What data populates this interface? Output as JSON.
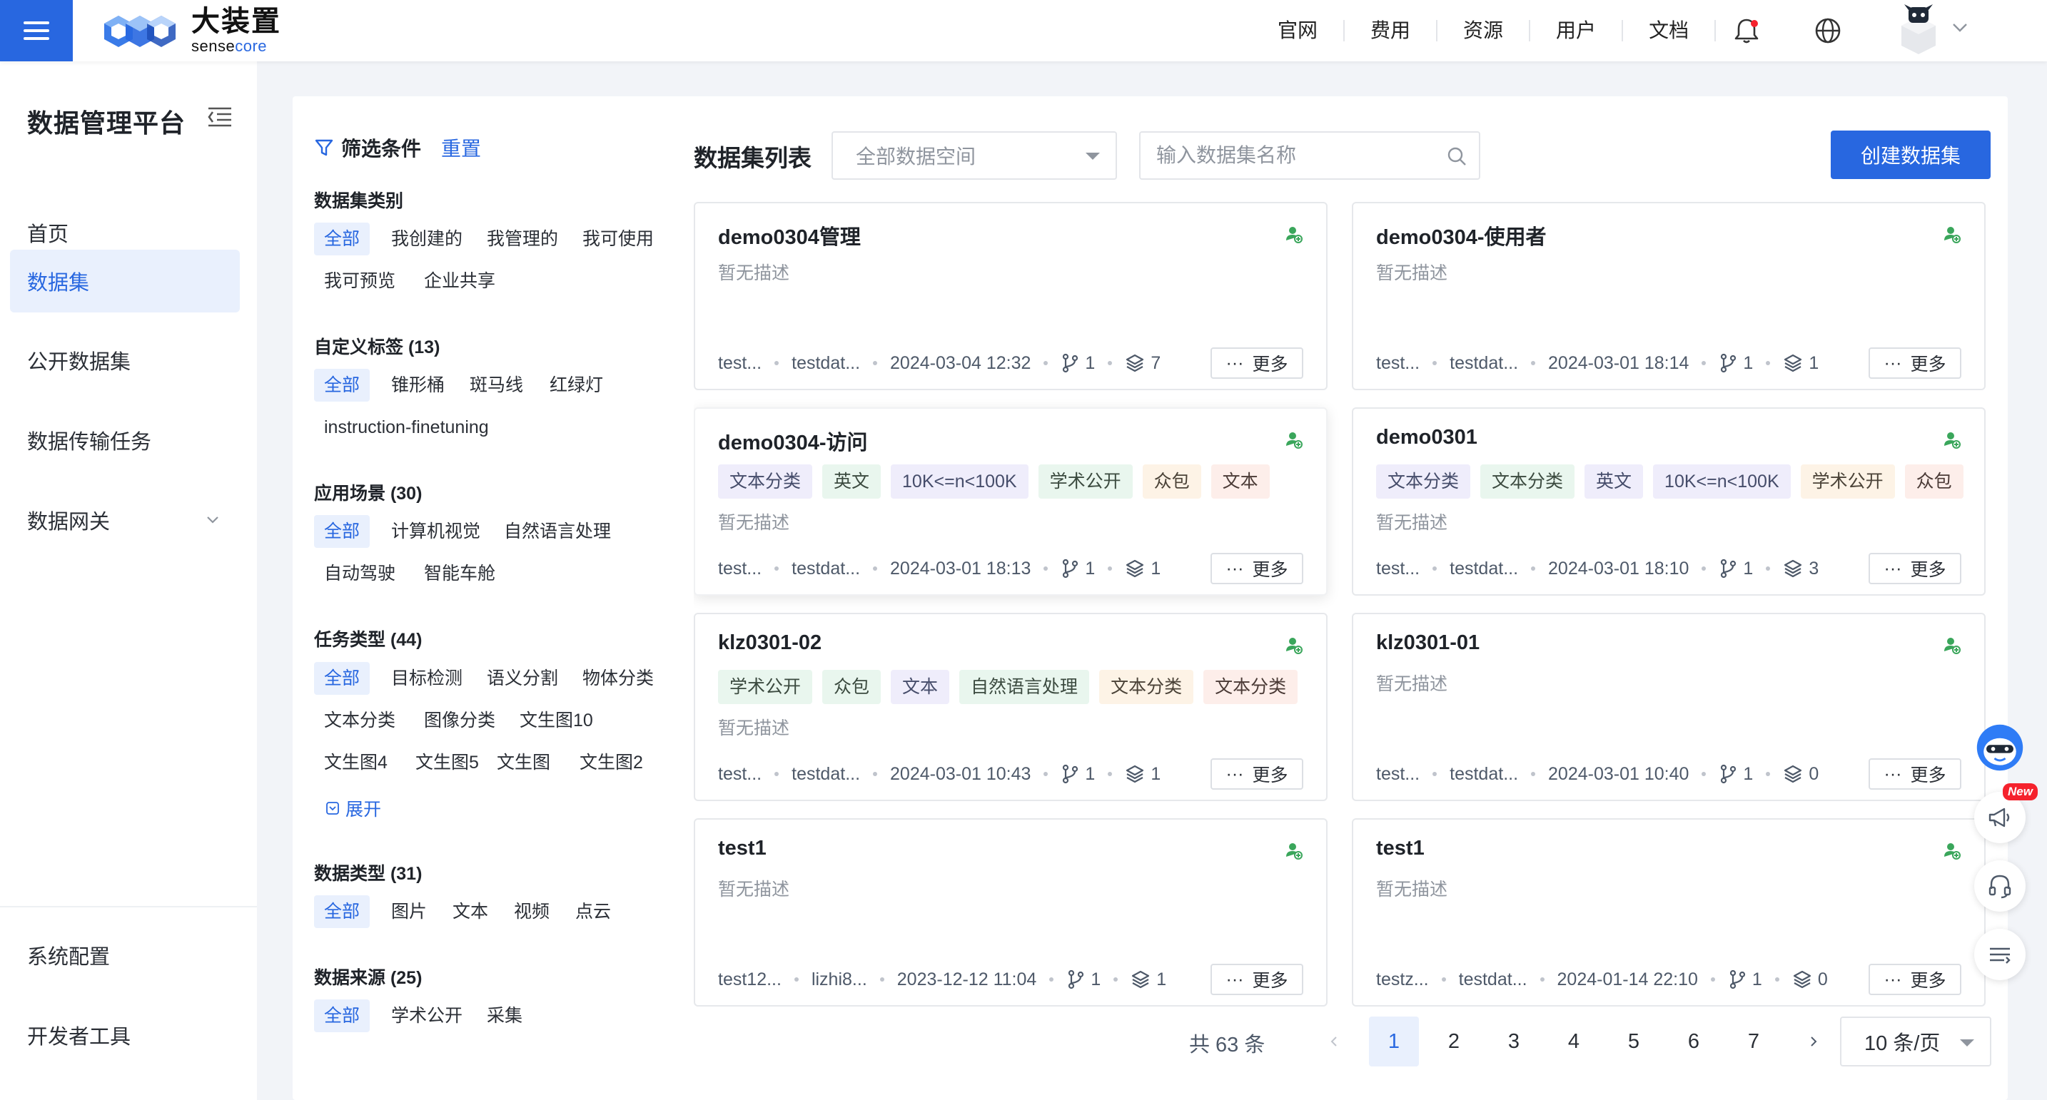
{
  "brand": {
    "name_cn": "大装置",
    "name_en_1": "sense",
    "name_en_2": "core"
  },
  "topnav": [
    {
      "label": "官网"
    },
    {
      "label": "费用"
    },
    {
      "label": "资源"
    },
    {
      "label": "用户"
    },
    {
      "label": "文档"
    }
  ],
  "sidebar": {
    "title": "数据管理平台",
    "items": [
      {
        "label": "首页"
      },
      {
        "label": "数据集"
      },
      {
        "label": "公开数据集"
      },
      {
        "label": "数据传输任务"
      },
      {
        "label": "数据网关"
      }
    ],
    "bottom": [
      {
        "label": "系统配置"
      },
      {
        "label": "开发者工具"
      }
    ]
  },
  "filter": {
    "title": "筛选条件",
    "reset": "重置",
    "groups": [
      {
        "title": "数据集类别",
        "chips": [
          "全部",
          "我创建的",
          "我管理的",
          "我可使用",
          "我可预览",
          "企业共享"
        ]
      },
      {
        "title": "自定义标签 (13)",
        "chips": [
          "全部",
          "锥形桶",
          "斑马线",
          "红绿灯",
          "instruction-finetuning"
        ]
      },
      {
        "title": "应用场景 (30)",
        "chips": [
          "全部",
          "计算机视觉",
          "自然语言处理",
          "自动驾驶",
          "智能车舱"
        ]
      },
      {
        "title": "任务类型 (44)",
        "chips": [
          "全部",
          "目标检测",
          "语义分割",
          "物体分类",
          "文本分类",
          "图像分类",
          "文生图10",
          "文生图4",
          "文生图5",
          "文生图",
          "文生图2"
        ],
        "expand": "展开"
      },
      {
        "title": "数据类型 (31)",
        "chips": [
          "全部",
          "图片",
          "文本",
          "视频",
          "点云"
        ]
      },
      {
        "title": "数据来源 (25)",
        "chips": [
          "全部",
          "学术公开",
          "采集"
        ]
      }
    ]
  },
  "list": {
    "title": "数据集列表",
    "space_select": "全部数据空间",
    "search_placeholder": "输入数据集名称",
    "create_label": "创建数据集",
    "more_label": "更多",
    "cards": [
      {
        "name": "demo0304管理",
        "tags": [],
        "desc": "暂无描述",
        "owner": "test...",
        "space": "testdat...",
        "time": "2024-03-04 12:32",
        "branches": "1",
        "versions": "7"
      },
      {
        "name": "demo0304-使用者",
        "tags": [],
        "desc": "暂无描述",
        "owner": "test...",
        "space": "testdat...",
        "time": "2024-03-01 18:14",
        "branches": "1",
        "versions": "1"
      },
      {
        "name": "demo0304-访问",
        "tags": [
          {
            "text": "文本分类",
            "color": "purple"
          },
          {
            "text": "英文",
            "color": "green"
          },
          {
            "text": "10K<=n<100K",
            "color": "purple"
          },
          {
            "text": "学术公开",
            "color": "green"
          },
          {
            "text": "众包",
            "color": "orange"
          },
          {
            "text": "文本",
            "color": "red"
          }
        ],
        "desc": "暂无描述",
        "owner": "test...",
        "space": "testdat...",
        "time": "2024-03-01 18:13",
        "branches": "1",
        "versions": "1"
      },
      {
        "name": "demo0301",
        "tags": [
          {
            "text": "文本分类",
            "color": "purple"
          },
          {
            "text": "文本分类",
            "color": "green"
          },
          {
            "text": "英文",
            "color": "purple"
          },
          {
            "text": "10K<=n<100K",
            "color": "purple"
          },
          {
            "text": "学术公开",
            "color": "orange"
          },
          {
            "text": "众包",
            "color": "red"
          }
        ],
        "desc": "暂无描述",
        "owner": "test...",
        "space": "testdat...",
        "time": "2024-03-01 18:10",
        "branches": "1",
        "versions": "3"
      },
      {
        "name": "klz0301-02",
        "tags": [
          {
            "text": "学术公开",
            "color": "green"
          },
          {
            "text": "众包",
            "color": "green"
          },
          {
            "text": "文本",
            "color": "purple"
          },
          {
            "text": "自然语言处理",
            "color": "green"
          },
          {
            "text": "文本分类",
            "color": "orange"
          },
          {
            "text": "文本分类",
            "color": "red"
          }
        ],
        "desc": "暂无描述",
        "owner": "test...",
        "space": "testdat...",
        "time": "2024-03-01 10:43",
        "branches": "1",
        "versions": "1"
      },
      {
        "name": "klz0301-01",
        "tags": [],
        "desc": "暂无描述",
        "owner": "test...",
        "space": "testdat...",
        "time": "2024-03-01 10:40",
        "branches": "1",
        "versions": "0"
      },
      {
        "name": "test1",
        "tags": [],
        "desc": "暂无描述",
        "owner": "test12...",
        "space": "lizhi8...",
        "time": "2023-12-12 11:04",
        "branches": "1",
        "versions": "1"
      },
      {
        "name": "test1",
        "tags": [],
        "desc": "暂无描述",
        "owner": "testz...",
        "space": "testdat...",
        "time": "2024-01-14 22:10",
        "branches": "1",
        "versions": "0"
      }
    ]
  },
  "pagination": {
    "total": "共 63 条",
    "pages": [
      "1",
      "2",
      "3",
      "4",
      "5",
      "6",
      "7"
    ],
    "current": "1",
    "page_size": "10 条/页"
  },
  "float_tools": {
    "new_badge": "New"
  },
  "colors": {
    "primary": "#2867e0",
    "permission_icon": "#3aa65b"
  }
}
